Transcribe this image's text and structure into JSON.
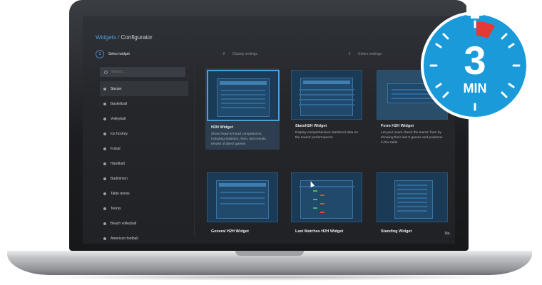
{
  "configurator": {
    "breadcrumb": "Widgets",
    "separator": "/",
    "title": "Configurator"
  },
  "steps": [
    {
      "num": "1",
      "label": "Select widget"
    },
    {
      "num": "2",
      "label": "Display settings"
    },
    {
      "num": "3",
      "label": "Colors settings"
    }
  ],
  "search": {
    "placeholder": "Search..."
  },
  "sports": [
    "Soccer",
    "Basketball",
    "Volleyball",
    "Ice hockey",
    "Futsal",
    "Handball",
    "Badminton",
    "Table tennis",
    "Tennis",
    "Beach volleyball",
    "American football"
  ],
  "widgets": [
    {
      "title": "H2H Widget",
      "desc": "Show head-to-head comparisons, including statistics, form, last results, results of direct games"
    },
    {
      "title": "StatsH2H Widget",
      "desc": "Display comprehensive statistical data on the teams' performances"
    },
    {
      "title": "Form H2H Widget",
      "desc": "Let your users check the teams' form by showing their last 5 games and positions in the table"
    },
    {
      "title": "General H2H Widget"
    },
    {
      "title": "Last Matches H2H Widget"
    },
    {
      "title": "Standing Widget"
    }
  ],
  "next_button": "Ne",
  "badge": {
    "number": "3",
    "unit": "MIN"
  },
  "colors": {
    "accent": "#4f9ed6",
    "badge": "#1a9ad9",
    "badge_red": "#e53935"
  }
}
